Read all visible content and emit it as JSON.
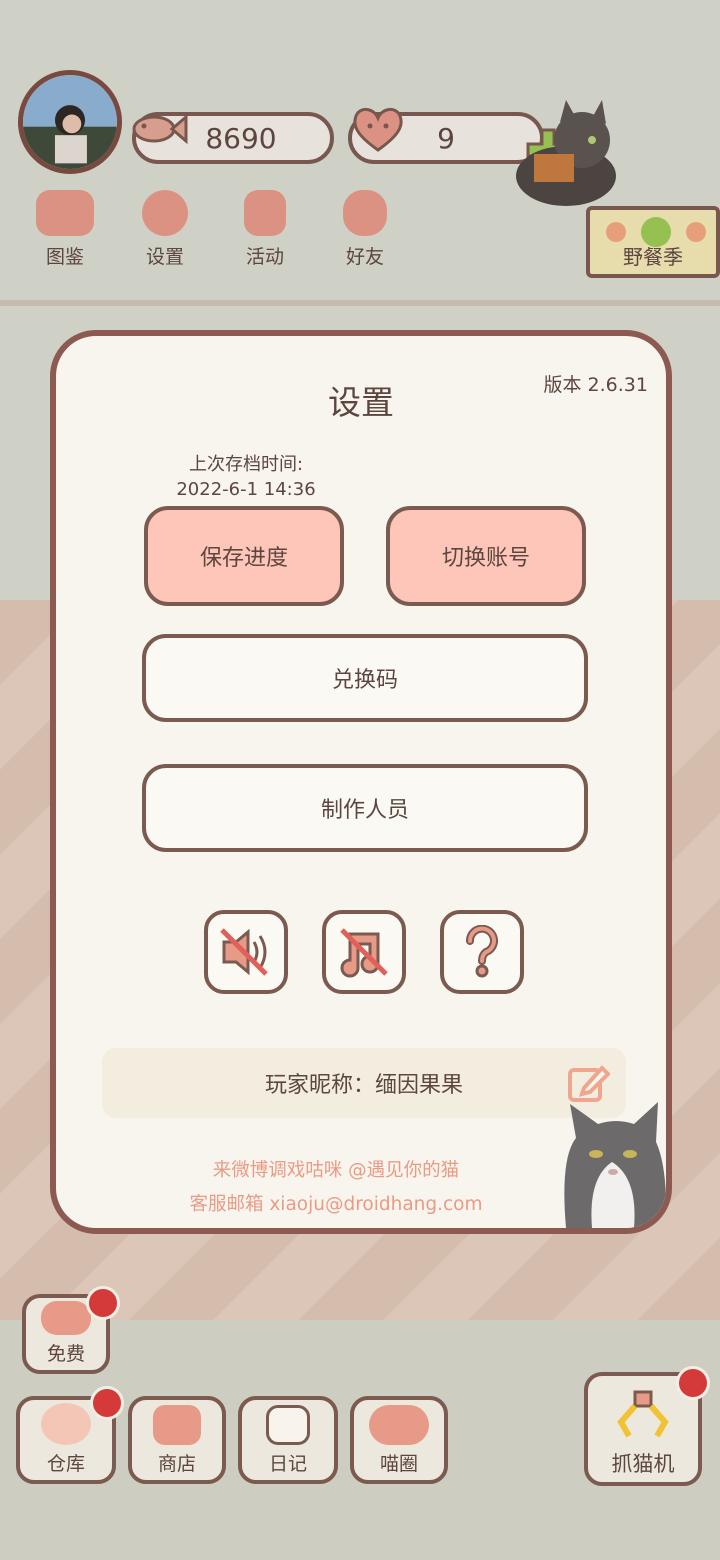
{
  "hud": {
    "coins": "8690",
    "hearts": "9"
  },
  "top_menu": [
    {
      "label": "图鉴",
      "icon": "cat-head-icon"
    },
    {
      "label": "设置",
      "icon": "gear-icon"
    },
    {
      "label": "活动",
      "icon": "gift-icon"
    },
    {
      "label": "好友",
      "icon": "friends-icon"
    }
  ],
  "event_banner": {
    "label": "野餐季"
  },
  "settings": {
    "title": "设置",
    "version": "版本 2.6.31",
    "save_time_label": "上次存档时间:",
    "save_time_value": "2022-6-1 14:36",
    "save_button": "保存进度",
    "switch_button": "切换账号",
    "redeem_button": "兑换码",
    "credits_button": "制作人员",
    "toggles": [
      {
        "name": "sound-off",
        "icon": "sound-muted-icon"
      },
      {
        "name": "music-off",
        "icon": "music-muted-icon"
      },
      {
        "name": "help",
        "icon": "question-icon"
      }
    ],
    "nickname": "玩家昵称：缅因果果",
    "weibo": "来微博调戏咕咪 @遇见你的猫",
    "email": "客服邮箱 xiaoju@droidhang.com"
  },
  "bottom_nav": {
    "free": "免费",
    "storage": "仓库",
    "shop": "商店",
    "diary": "日记",
    "circle": "喵圈",
    "claw": "抓猫机"
  },
  "colors": {
    "accent_pink": "#fec5b9",
    "border_brown": "#7b5a50",
    "contact_text": "#e99b86",
    "badge_red": "#d43a3a"
  }
}
